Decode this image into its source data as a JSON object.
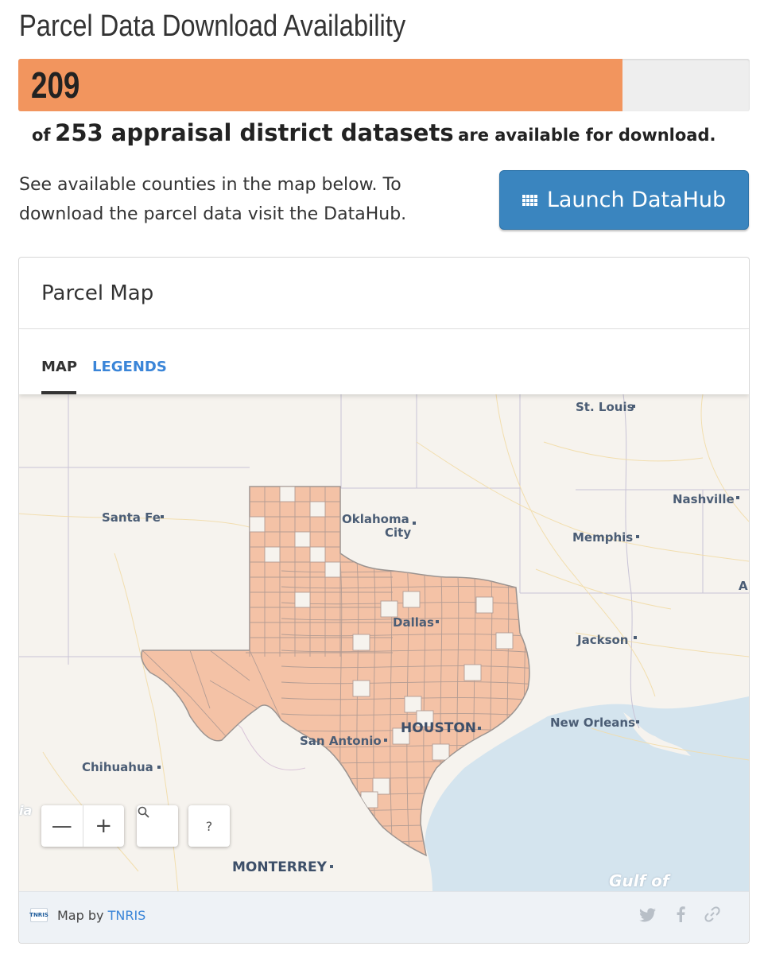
{
  "header": {
    "title": "Parcel Data Download Availability"
  },
  "progress": {
    "value_text": "209",
    "available": 209,
    "total": 253,
    "fill_color": "#f2955e"
  },
  "summary": {
    "prefix": "of",
    "highlight": "253 appraisal district datasets",
    "suffix": "are available for download."
  },
  "description": {
    "line1": "See available counties in the map below. To",
    "line2": "download the parcel data visit the DataHub."
  },
  "launch_button": {
    "label": "Launch DataHub",
    "icon": "grid-icon",
    "color": "#3a85bf"
  },
  "card": {
    "title": "Parcel Map",
    "tabs": [
      {
        "label": "MAP",
        "active": true
      },
      {
        "label": "LEGENDS",
        "active": false
      }
    ]
  },
  "map": {
    "county_fill_color": "#f4c2a6",
    "labels": {
      "st_louis": "St. Louis",
      "nashville": "Nashville",
      "santa_fe": "Santa Fe",
      "oklahoma_city_1": "Oklahoma",
      "oklahoma_city_2": "City",
      "memphis": "Memphis",
      "dallas": "Dallas",
      "jackson": "Jackson",
      "houston": "HOUSTON",
      "new_orleans": "New Orleans",
      "san_antonio": "San Antonio",
      "chihuahua": "Chihuahua",
      "monterrey": "MONTERREY",
      "gulf": "Gulf of",
      "edge_a": "A",
      "edge_ia": "ia"
    },
    "controls": {
      "zoom_out": "—",
      "zoom_in": "+",
      "search_icon": "search-icon",
      "help": "?"
    }
  },
  "footer": {
    "prefix": "Map by",
    "link": "TNRIS",
    "logo_text": "TNRIS",
    "icons": [
      "twitter-icon",
      "facebook-icon",
      "link-icon"
    ]
  }
}
